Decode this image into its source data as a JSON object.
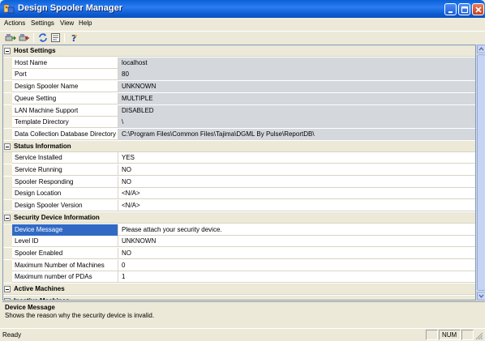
{
  "window": {
    "title": "Design Spooler Manager"
  },
  "menu": [
    "Actions",
    "Settings",
    "View",
    "Help"
  ],
  "toolbar": {
    "buttons": [
      "connect-icon",
      "disconnect-icon",
      "refresh-icon",
      "properties-icon",
      "help-icon"
    ]
  },
  "sections": [
    {
      "title": "Host Settings",
      "rows": [
        {
          "name": "Host Name",
          "value": "localhost"
        },
        {
          "name": "Port",
          "value": "80"
        },
        {
          "name": "Design Spooler Name",
          "value": "UNKNOWN"
        },
        {
          "name": "Queue Setting",
          "value": "MULTIPLE"
        },
        {
          "name": "LAN Machine Support",
          "value": "DISABLED"
        },
        {
          "name": "Template Directory",
          "value": "\\"
        },
        {
          "name": "Data Collection Database Directory",
          "value": "C:\\Program Files\\Common Files\\Tajima\\DGML By Pulse\\ReportDB\\"
        }
      ]
    },
    {
      "title": "Status Information",
      "rows": [
        {
          "name": "Service Installed",
          "value": "YES"
        },
        {
          "name": "Service Running",
          "value": "NO"
        },
        {
          "name": "Spooler Responding",
          "value": "NO"
        },
        {
          "name": "Design Location",
          "value": "<N/A>"
        },
        {
          "name": "Design Spooler Version",
          "value": "<N/A>"
        }
      ]
    },
    {
      "title": "Security Device Information",
      "rows": [
        {
          "name": "Device Message",
          "value": "Please attach your security device."
        },
        {
          "name": "Level ID",
          "value": "UNKNOWN"
        },
        {
          "name": "Spooler Enabled",
          "value": "NO"
        },
        {
          "name": "Maximum Number of Machines",
          "value": "0"
        },
        {
          "name": "Maximum number of PDAs",
          "value": "1"
        }
      ]
    },
    {
      "title": "Active Machines",
      "rows": []
    },
    {
      "title": "Inactive Machines",
      "rows": []
    }
  ],
  "help": {
    "title": "Device Message",
    "description": "Shows the reason why the security device is invalid."
  },
  "status": {
    "text": "Ready",
    "num": "NUM"
  }
}
